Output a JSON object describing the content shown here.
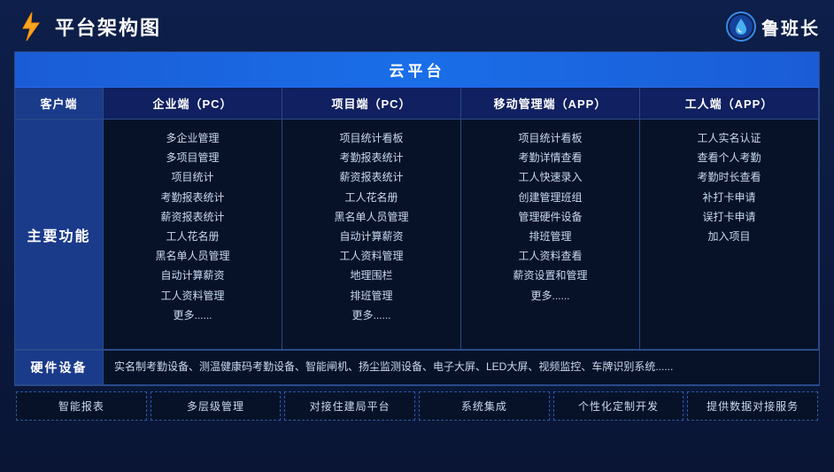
{
  "header": {
    "title": "平台架构图",
    "brand": "鲁班长"
  },
  "cloud_platform": "云平台",
  "columns": {
    "client": "客户端",
    "enterprise_pc": "企业端（PC）",
    "project_pc": "项目端（PC）",
    "mobile_app": "移动管理端（APP）",
    "worker_app": "工人端（APP）"
  },
  "row_label": "主要功能",
  "enterprise_features": [
    "多企业管理",
    "多项目管理",
    "项目统计",
    "考勤报表统计",
    "薪资报表统计",
    "工人花名册",
    "黑名单人员管理",
    "自动计算薪资",
    "工人资料管理",
    "更多......"
  ],
  "project_features": [
    "项目统计看板",
    "考勤报表统计",
    "薪资报表统计",
    "工人花名册",
    "黑名单人员管理",
    "自动计算薪资",
    "工人资料管理",
    "地理围栏",
    "排班管理",
    "更多......"
  ],
  "mobile_features": [
    "项目统计看板",
    "考勤详情查看",
    "工人快速录入",
    "创建管理班组",
    "管理硬件设备",
    "排班管理",
    "工人资料查看",
    "薪资设置和管理",
    "更多......"
  ],
  "worker_features": [
    "工人实名认证",
    "查看个人考勤",
    "考勤时长查看",
    "补打卡申请",
    "误打卡申请",
    "加入项目"
  ],
  "hardware": {
    "label": "硬件设备",
    "content": "实名制考勤设备、测温健康码考勤设备、智能闸机、扬尘监测设备、电子大屏、LED大屏、视频监控、车牌识别系统......"
  },
  "bottom_features": [
    "智能报表",
    "多层级管理",
    "对接住建局平台",
    "系统集成",
    "个性化定制开发",
    "提供数据对接服务"
  ]
}
